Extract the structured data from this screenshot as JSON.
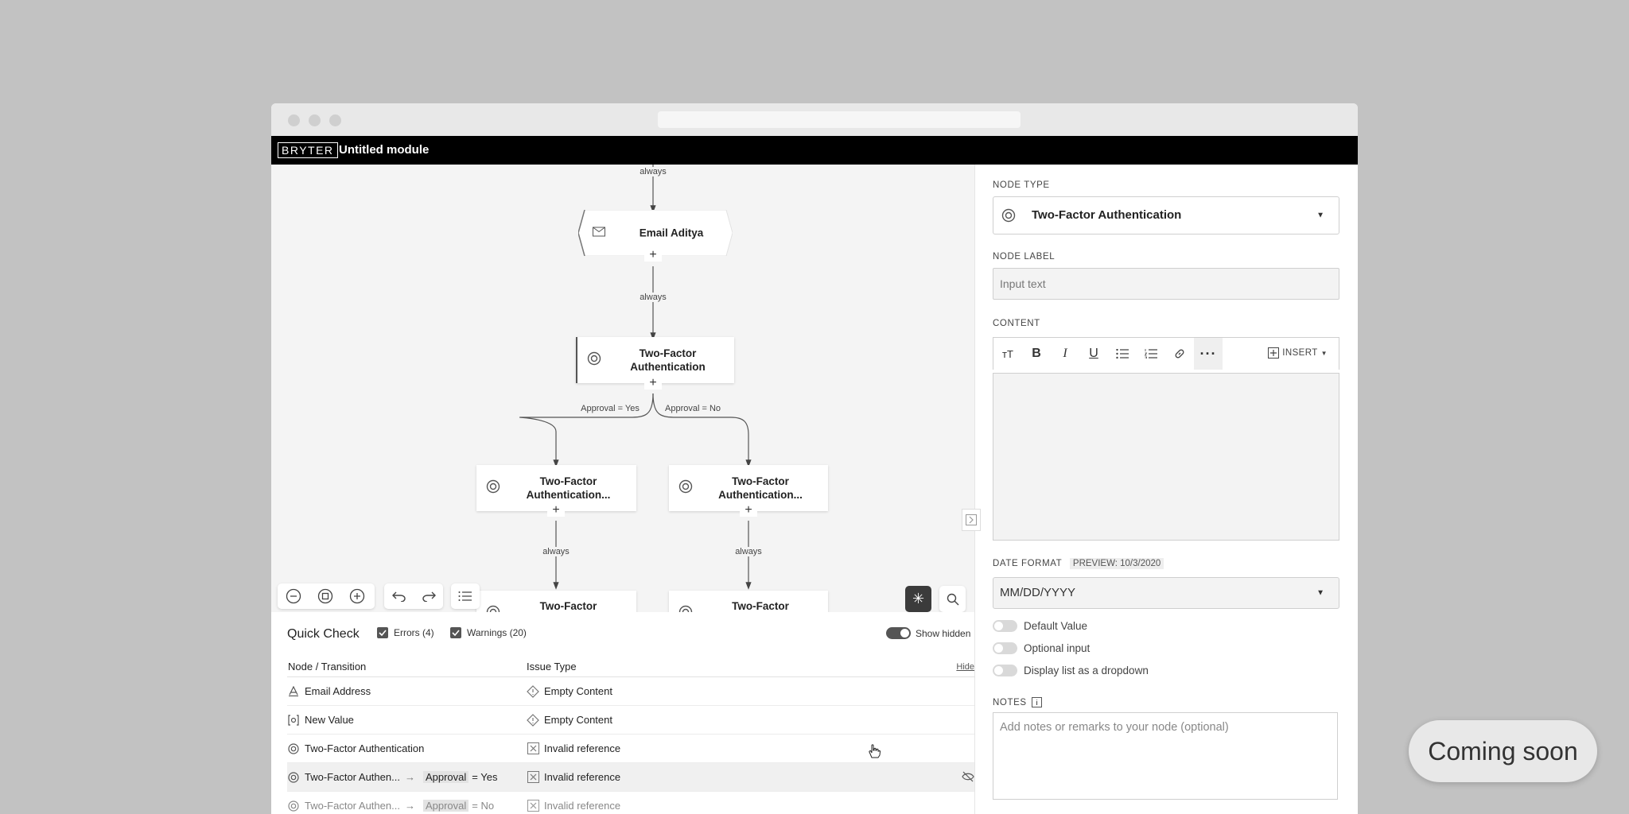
{
  "app": {
    "logo": "BRYTER",
    "module_title": "Untitled module"
  },
  "canvas": {
    "edge_labels": {
      "top": "always",
      "email_to_tfa": "always",
      "branch_yes": "Approval = Yes",
      "branch_no": "Approval = No",
      "left_down": "always",
      "right_down": "always"
    },
    "nodes": {
      "email": "Email Aditya",
      "tfa_main": "Two-Factor Authentication",
      "tfa_left": "Two-Factor Authentication...",
      "tfa_right": "Two-Factor Authentication...",
      "tfa_bottom_left": "Two-Factor",
      "tfa_bottom_right": "Two-Factor"
    },
    "plus": "+"
  },
  "quick_check": {
    "title": "Quick Check",
    "errors_label": "Errors (4)",
    "warnings_label": "Warnings (20)",
    "show_hidden_label": "Show hidden",
    "col_node": "Node / Transition",
    "col_issue": "Issue Type",
    "hide": "Hide",
    "rows": [
      {
        "node": "Email Address",
        "issue": "Empty Content"
      },
      {
        "node": "New Value",
        "issue": "Empty Content"
      },
      {
        "node": "Two-Factor Authentication",
        "issue": "Invalid reference"
      },
      {
        "node": "Two-Factor Authen...",
        "field": "Approval",
        "cond": "= Yes",
        "issue": "Invalid reference"
      },
      {
        "node": "Two-Factor Authen...",
        "field": "Approval",
        "cond": "= No",
        "issue": "Invalid reference"
      }
    ]
  },
  "panel": {
    "node_type_label": "NODE TYPE",
    "node_type_value": "Two-Factor Authentication",
    "node_label_label": "NODE LABEL",
    "node_label_placeholder": "Input text",
    "content_label": "CONTENT",
    "insert_label": "INSERT",
    "date_format_label": "DATE FORMAT",
    "preview_label": "PREVIEW:",
    "preview_value": "10/3/2020",
    "date_format_value": "MM/DD/YYYY",
    "options": [
      "Default Value",
      "Optional input",
      "Display list as a dropdown"
    ],
    "notes_label": "NOTES",
    "notes_placeholder": "Add notes or remarks to your node (optional)"
  },
  "badge": {
    "coming_soon": "Coming soon"
  }
}
